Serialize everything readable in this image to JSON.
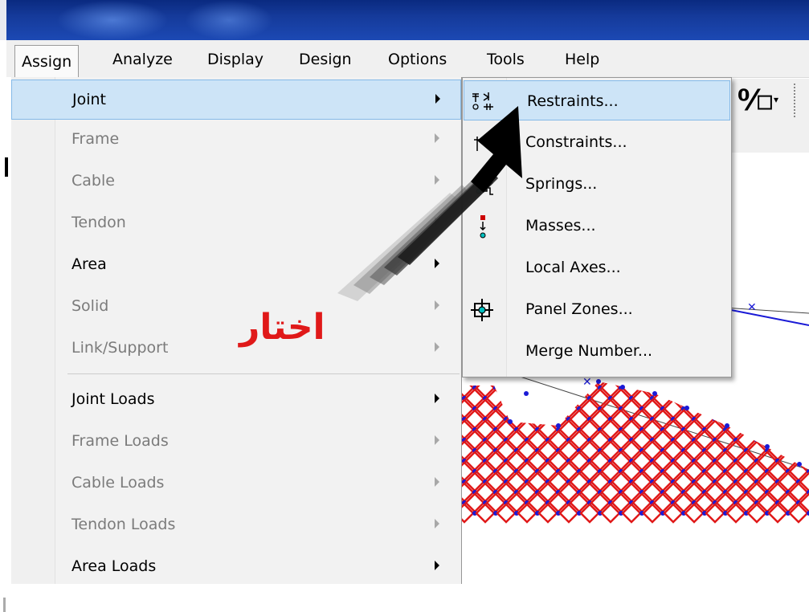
{
  "menubar": {
    "items": [
      "Assign",
      "Analyze",
      "Display",
      "Design",
      "Options",
      "Tools",
      "Help"
    ]
  },
  "assign_menu": {
    "items": [
      {
        "label": "Joint",
        "enabled": true,
        "highlighted": true
      },
      {
        "label": "Frame",
        "enabled": false
      },
      {
        "label": "Cable",
        "enabled": false
      },
      {
        "label": "Tendon",
        "enabled": false
      },
      {
        "label": "Area",
        "enabled": true
      },
      {
        "label": "Solid",
        "enabled": false
      },
      {
        "label": "Link/Support",
        "enabled": false
      },
      {
        "label": "Joint Loads",
        "enabled": true
      },
      {
        "label": "Frame Loads",
        "enabled": false
      },
      {
        "label": "Cable Loads",
        "enabled": false
      },
      {
        "label": "Tendon Loads",
        "enabled": false
      },
      {
        "label": "Area Loads",
        "enabled": true
      }
    ]
  },
  "joint_submenu": {
    "items": [
      {
        "label": "Restraints...",
        "icon": "restraints-icon",
        "highlighted": true
      },
      {
        "label": "Constraints...",
        "icon": "constraints-icon"
      },
      {
        "label": "Springs...",
        "icon": "springs-icon"
      },
      {
        "label": "Masses...",
        "icon": "masses-icon"
      },
      {
        "label": "Local Axes...",
        "icon": ""
      },
      {
        "label": "Panel Zones...",
        "icon": "panel-zones-icon"
      },
      {
        "label": "Merge Number...",
        "icon": ""
      }
    ]
  },
  "annotation": {
    "text": "اختار",
    "color": "#e01919"
  },
  "colors": {
    "highlight": "#cde4f7",
    "highlight_border": "#84b9e8",
    "mesh_red": "#e01919",
    "mesh_blue": "#1a1ad6"
  }
}
